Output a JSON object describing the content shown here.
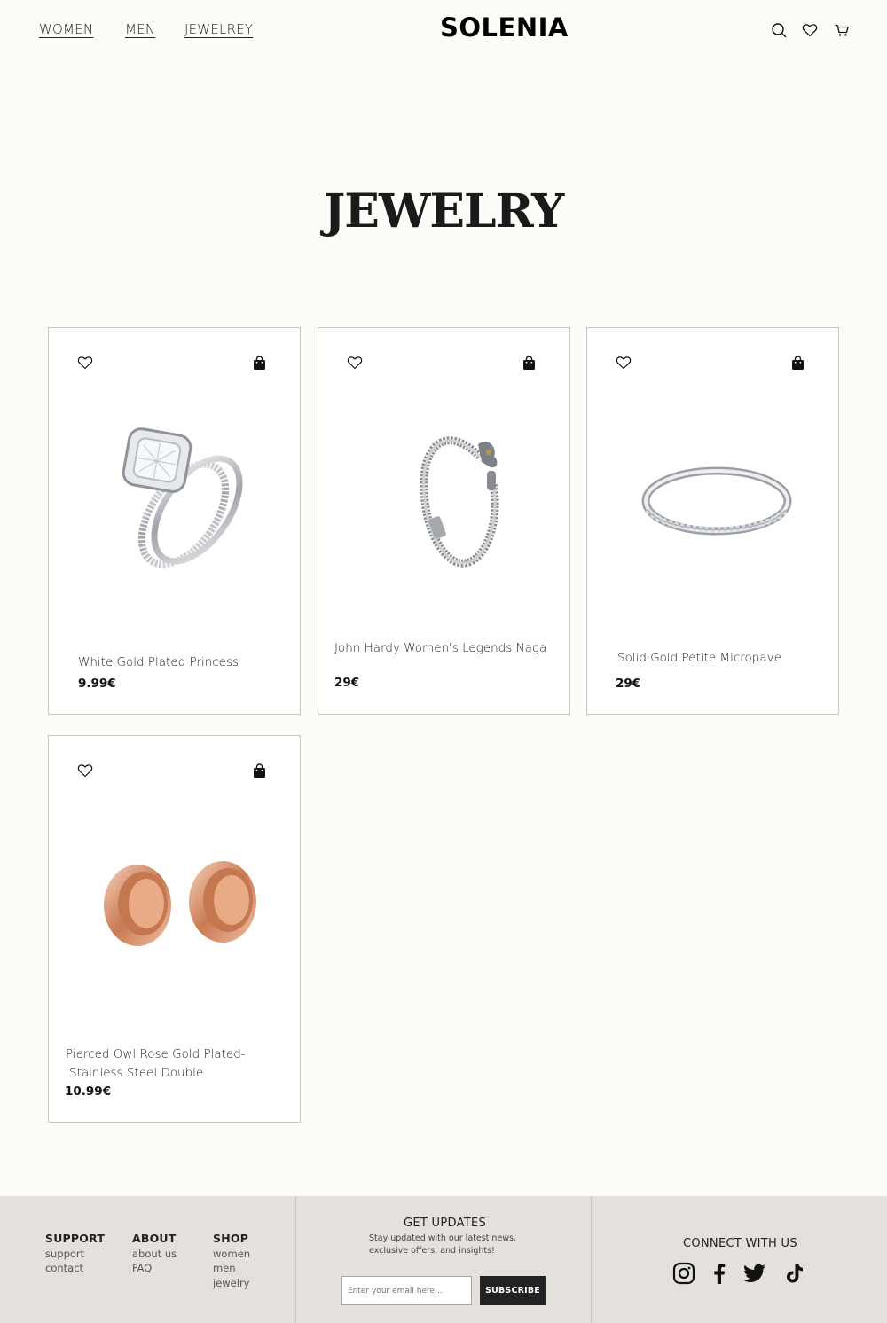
{
  "header": {
    "nav": [
      "WOMEN",
      "MEN",
      "JEWELREY"
    ],
    "logo": "SOLENIA",
    "icons": [
      "search-icon",
      "heart-icon",
      "cart-icon"
    ]
  },
  "page": {
    "title": "JEWELRY"
  },
  "products": [
    {
      "name_lines": [
        "White Gold Plated Princess"
      ],
      "price": "9.99€",
      "image": "diamond-engagement-ring"
    },
    {
      "name_lines": [
        "John Hardy Women's Legends Naga"
      ],
      "price": "29€",
      "image": "silver-chain-bracelet"
    },
    {
      "name_lines": [
        "Solid Gold Petite Micropave"
      ],
      "price": "29€",
      "image": "silver-pave-band-ring"
    },
    {
      "name_lines": [
        "Pierced Owl Rose Gold Plated-",
        "Stainless Steel Double"
      ],
      "price": "10.99€",
      "image": "rose-gold-tunnel-plugs"
    }
  ],
  "footer": {
    "support": {
      "heading": "SUPPORT",
      "links": [
        "support",
        "contact"
      ]
    },
    "about": {
      "heading": "ABOUT",
      "links": [
        "about us",
        "FAQ"
      ]
    },
    "shop": {
      "heading": "SHOP",
      "links": [
        "women",
        "men",
        "jewelry"
      ]
    },
    "updates": {
      "title": "GET UPDATES",
      "text_lines": [
        "Stay updated with our latest news,",
        "exclusive offers, and insights!"
      ],
      "email_placeholder": "Enter your email here...",
      "button": "SUBSCRIBE"
    },
    "connect": {
      "title": "CONNECT WITH US",
      "icons": [
        "instagram-icon",
        "facebook-icon",
        "twitter-icon",
        "tiktok-icon"
      ]
    }
  }
}
